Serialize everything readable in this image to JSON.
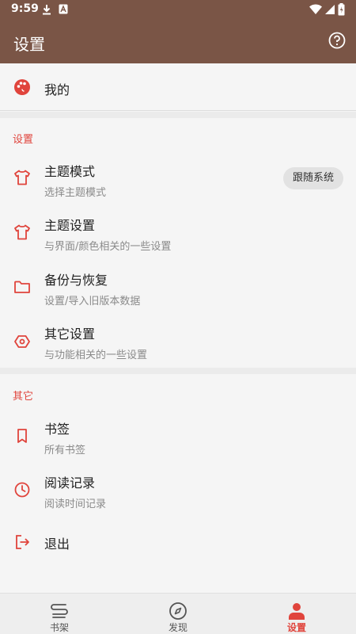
{
  "status_bar": {
    "time": "9:59"
  },
  "app_bar": {
    "title": "设置"
  },
  "my": {
    "label": "我的"
  },
  "settings_section": {
    "header": "设置",
    "items": [
      {
        "title": "主题模式",
        "subtitle": "选择主题模式",
        "value": "跟随系统"
      },
      {
        "title": "主题设置",
        "subtitle": "与界面/颜色相关的一些设置"
      },
      {
        "title": "备份与恢复",
        "subtitle": "设置/导入旧版本数据"
      },
      {
        "title": "其它设置",
        "subtitle": "与功能相关的一些设置"
      }
    ]
  },
  "other_section": {
    "header": "其它",
    "items": [
      {
        "title": "书签",
        "subtitle": "所有书签"
      },
      {
        "title": "阅读记录",
        "subtitle": "阅读时间记录"
      },
      {
        "title": "退出"
      }
    ]
  },
  "bottom_nav": {
    "items": [
      {
        "label": "书架"
      },
      {
        "label": "发现"
      },
      {
        "label": "设置"
      }
    ],
    "active_index": 2
  },
  "colors": {
    "primary": "#7a5546",
    "accent": "#e0443c",
    "background": "#f5f5f5"
  }
}
